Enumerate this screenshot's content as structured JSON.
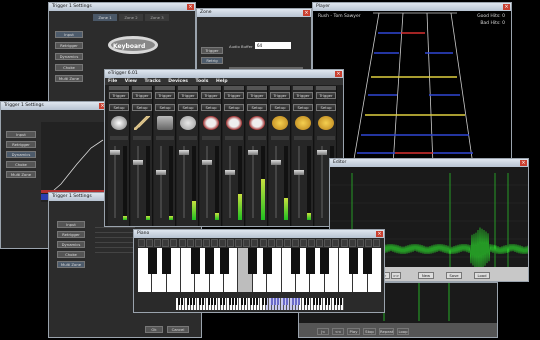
{
  "settings_back": {
    "title": "Trigger 1 Settings",
    "zones": [
      "Zone 1",
      "Zone 2",
      "Zone 3"
    ],
    "side_buttons": [
      "Input",
      "Retrigger",
      "Dynamics",
      "Choke",
      "Multi Zone"
    ],
    "keyboard_label": "Keyboard",
    "accent": "#3a78c8"
  },
  "small_win": {
    "title": "Zone",
    "button_a": "Trigger",
    "button_b": "Retrig"
  },
  "audio_prefs": {
    "label": "Audio Buffer",
    "value": "64"
  },
  "player": {
    "title": "Player",
    "song": "Rush - Tom Sawyer",
    "good_hits": "Good Hits: 0",
    "bad_hits": "Bad Hits: 0",
    "line_colors": [
      "#3047d6",
      "#d83030",
      "#e0d040"
    ]
  },
  "trigger_left": {
    "title": "Trigger 1 Settings",
    "buttons": [
      "Input",
      "Retrigger",
      "Dynamics",
      "Choke",
      "Multi Zone"
    ],
    "curve_color": "#3080ff"
  },
  "trigger_lower": {
    "title": "Trigger 1 Settings",
    "buttons": [
      "Input",
      "Retrigger",
      "Dynamics",
      "Choke",
      "Multi Zone"
    ],
    "ok": "Ok",
    "cancel": "Cancel"
  },
  "mixer": {
    "title": "eTrigger 6.01",
    "menu": [
      "File",
      "View",
      "Tracks",
      "Devices",
      "Tools",
      "Help"
    ],
    "channels": [
      {
        "trigger": "Trigger",
        "setup": "Setup",
        "icon": "cymbal-icon",
        "level": 0.05
      },
      {
        "trigger": "Trigger",
        "setup": "Setup",
        "icon": "sticks-icon",
        "level": 0.05
      },
      {
        "trigger": "Trigger",
        "setup": "Setup",
        "icon": "cowbell-icon",
        "level": 0.05
      },
      {
        "trigger": "Trigger",
        "setup": "Setup",
        "icon": "snare-icon",
        "level": 0.25
      },
      {
        "trigger": "Trigger",
        "setup": "Setup",
        "icon": "tom-icon",
        "level": 0.1
      },
      {
        "trigger": "Trigger",
        "setup": "Setup",
        "icon": "tom-icon",
        "level": 0.35
      },
      {
        "trigger": "Trigger",
        "setup": "Setup",
        "icon": "tom-icon",
        "level": 0.55
      },
      {
        "trigger": "Trigger",
        "setup": "Setup",
        "icon": "cymbal-gold-icon",
        "level": 0.3
      },
      {
        "trigger": "Trigger",
        "setup": "Setup",
        "icon": "cymbal-gold-icon",
        "level": 0.1
      },
      {
        "trigger": "Trigger",
        "setup": "Setup",
        "icon": "cymbal-gold-icon",
        "level": 0.4
      }
    ]
  },
  "editor": {
    "title": "Editor",
    "buttons": [
      "|<",
      "<<",
      "Play",
      "Stop",
      ">",
      ">>"
    ],
    "right_buttons": [
      "New",
      "Save",
      "Load"
    ],
    "wave_color": "#2bd12b"
  },
  "piano": {
    "title": "Piano",
    "highlight_key_color": "#bdbdbd",
    "mini_highlight_color": "#6a6ac8"
  },
  "bottom": {
    "buttons": [
      "|<",
      "<<",
      "Play",
      "Stop",
      "Repeat",
      "Loop"
    ]
  }
}
